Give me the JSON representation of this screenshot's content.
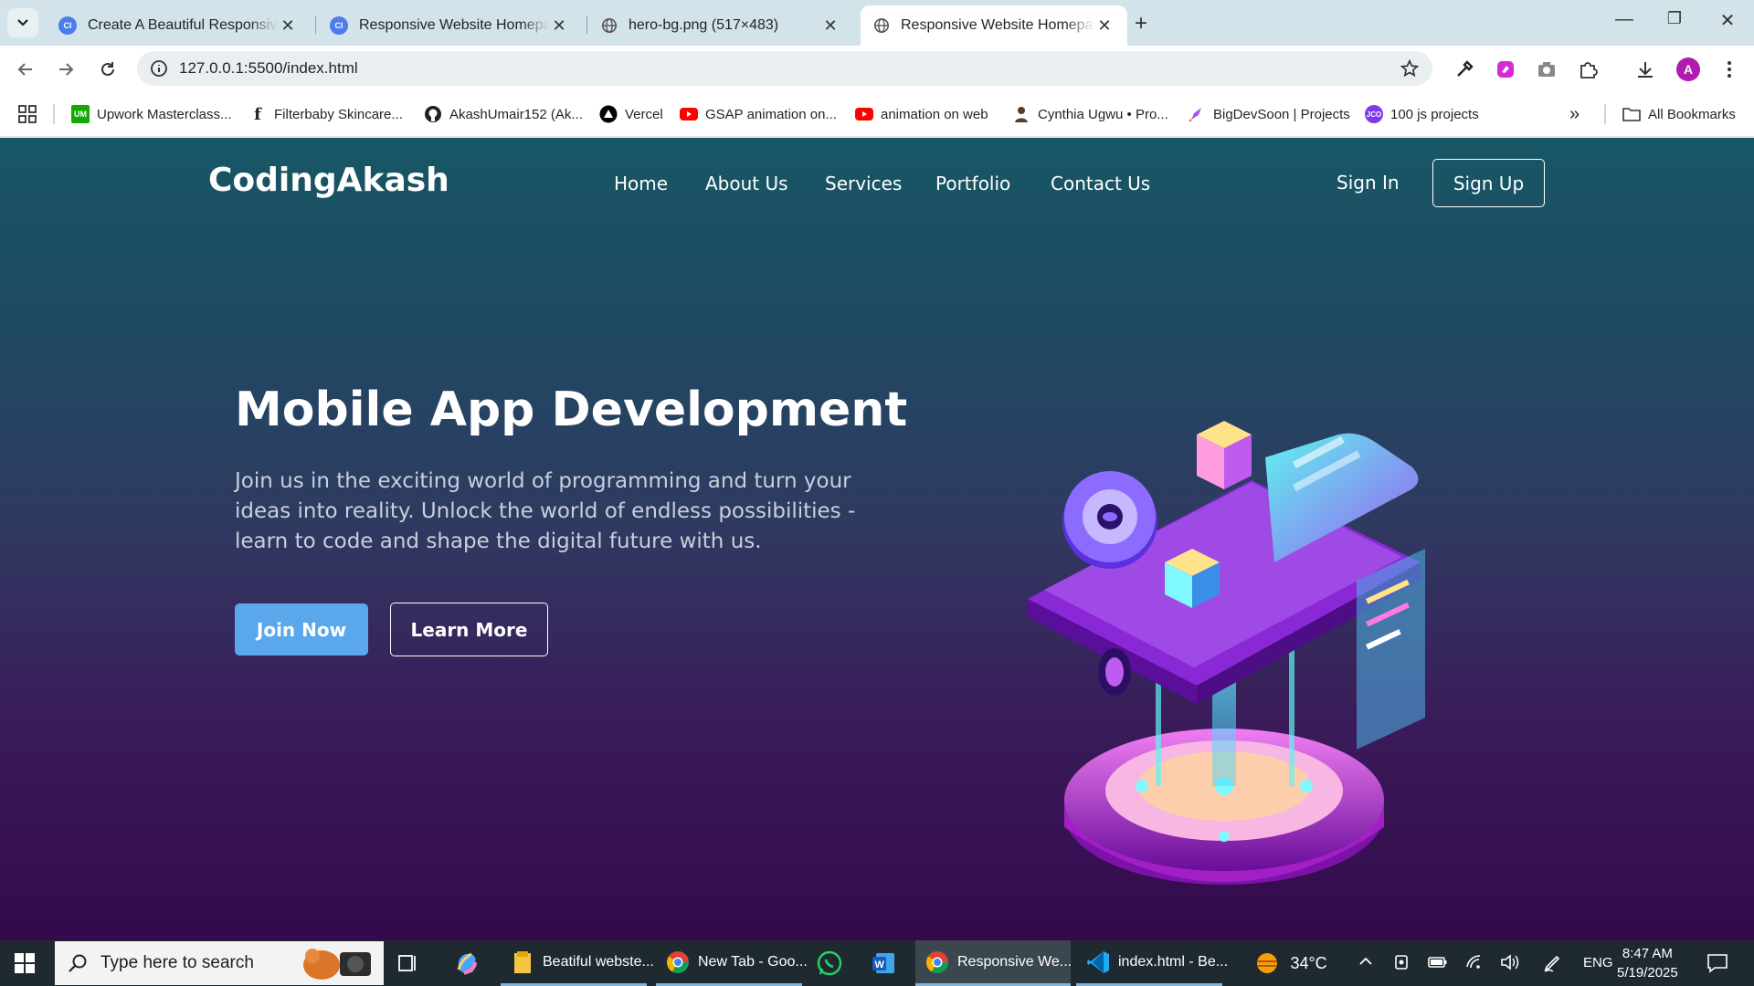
{
  "browser": {
    "tabs": [
      {
        "title": "Create A Beautiful Responsive W",
        "favicon": "ci-icon",
        "active": false
      },
      {
        "title": "Responsive Website Homepage",
        "favicon": "ci-icon",
        "active": false
      },
      {
        "title": "hero-bg.png (517×483)",
        "favicon": "globe-icon",
        "active": false
      },
      {
        "title": "Responsive Website Homepage",
        "favicon": "globe-icon",
        "active": true
      }
    ],
    "address": "127.0.0.1:5500/index.html",
    "bookmarks": [
      {
        "label": "Upwork Masterclass...",
        "icon": "upwork-icon"
      },
      {
        "label": "Filterbaby Skincare...",
        "icon": "filterbaby-icon"
      },
      {
        "label": "AkashUmair152 (Ak...",
        "icon": "github-icon"
      },
      {
        "label": "Vercel",
        "icon": "vercel-icon"
      },
      {
        "label": "GSAP animation on...",
        "icon": "youtube-icon"
      },
      {
        "label": "animation on web",
        "icon": "youtube-icon"
      },
      {
        "label": "Cynthia Ugwu • Pro...",
        "icon": "cynthia-icon"
      },
      {
        "label": "BigDevSoon | Projects",
        "icon": "rocket-icon"
      },
      {
        "label": "100 js projects",
        "icon": "js-projects-icon"
      }
    ],
    "all_bookmarks": "All Bookmarks",
    "avatar_letter": "A"
  },
  "site": {
    "logo": "CodingAkash",
    "nav": [
      "Home",
      "About Us",
      "Services",
      "Portfolio",
      "Contact Us"
    ],
    "sign_in": "Sign In",
    "sign_up": "Sign Up",
    "hero": {
      "title": "Mobile App Development",
      "text": "Join us in the exciting world of programming and turn your ideas into reality. Unlock the world of endless possibilities - learn to code and shape the digital future with us.",
      "join": "Join Now",
      "learn": "Learn More"
    },
    "colors": {
      "bg_top": "#175765",
      "bg_bottom": "#34094d",
      "primary_button": "#5ba7ec"
    }
  },
  "taskbar": {
    "search_placeholder": "Type here to search",
    "apps": [
      {
        "label": "Beatiful webste...",
        "icon": "folder-icon"
      },
      {
        "label": "New Tab - Goo...",
        "icon": "chrome-icon"
      },
      {
        "label": "",
        "icon": "whatsapp-icon"
      },
      {
        "label": "",
        "icon": "word-icon"
      },
      {
        "label": "Responsive We...",
        "icon": "chrome-icon"
      },
      {
        "label": "index.html - Be...",
        "icon": "vscode-icon"
      }
    ],
    "weather": "34°C",
    "language": "ENG",
    "time": "8:47 AM",
    "date": "5/19/2025"
  }
}
